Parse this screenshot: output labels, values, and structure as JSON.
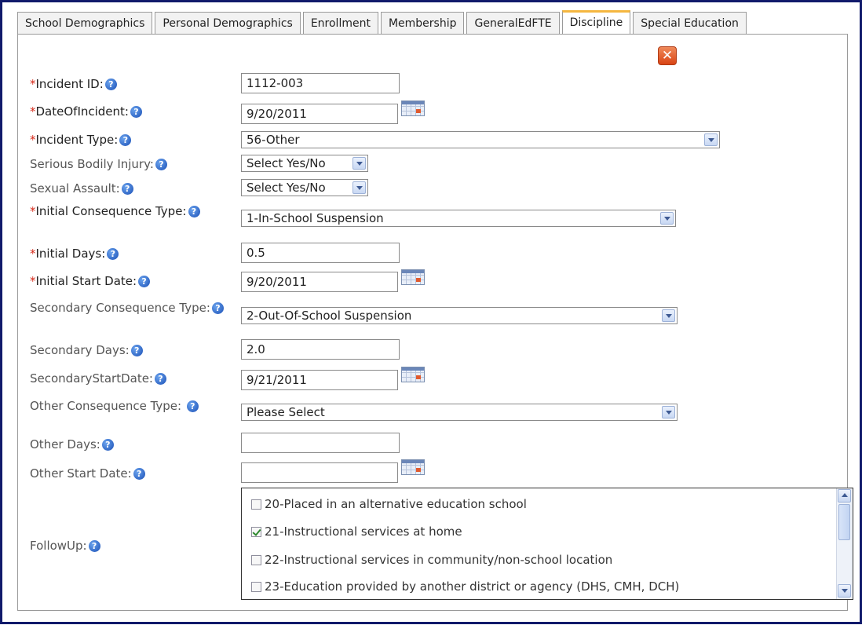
{
  "tabs": [
    {
      "label": "School Demographics",
      "active": false
    },
    {
      "label": "Personal Demographics",
      "active": false
    },
    {
      "label": "Enrollment",
      "active": false
    },
    {
      "label": "Membership",
      "active": false
    },
    {
      "label": "GeneralEdFTE",
      "active": false
    },
    {
      "label": "Discipline",
      "active": true
    },
    {
      "label": "Special Education",
      "active": false
    }
  ],
  "close_glyph": "✕",
  "required_mark": "*",
  "help_glyph": "?",
  "fields": {
    "incident_id": {
      "label": "Incident ID:",
      "value": "1112-003"
    },
    "date_of_incident": {
      "label": "DateOfIncident:",
      "value": "9/20/2011"
    },
    "incident_type": {
      "label": "Incident Type:",
      "value": "56-Other"
    },
    "serious_bodily_injury": {
      "label": "Serious Bodily Injury:",
      "value": "Select Yes/No"
    },
    "sexual_assault": {
      "label": "Sexual Assault:",
      "value": "Select Yes/No"
    },
    "initial_consequence_type": {
      "label": "Initial Consequence Type:",
      "value": "1-In-School Suspension"
    },
    "initial_days": {
      "label": "Initial Days:",
      "value": "0.5"
    },
    "initial_start_date": {
      "label": "Initial Start Date:",
      "value": "9/20/2011"
    },
    "secondary_consequence_type": {
      "label": "Secondary Consequence Type:",
      "value": "2-Out-Of-School Suspension"
    },
    "secondary_days": {
      "label": "Secondary Days:",
      "value": "2.0"
    },
    "secondary_start_date": {
      "label": "SecondaryStartDate:",
      "value": "9/21/2011"
    },
    "other_consequence_type": {
      "label": "Other Consequence Type:",
      "value": "Please Select"
    },
    "other_days": {
      "label": "Other Days:",
      "value": ""
    },
    "other_start_date": {
      "label": "Other Start Date:",
      "value": ""
    },
    "followup": {
      "label": "FollowUp:"
    }
  },
  "followup_options": [
    {
      "label": "20-Placed in an alternative education school",
      "checked": false
    },
    {
      "label": "21-Instructional services at home",
      "checked": true
    },
    {
      "label": "22-Instructional services in community/non-school location",
      "checked": false
    },
    {
      "label": "23-Education provided by another district or agency (DHS, CMH, DCH)",
      "checked": false
    }
  ],
  "colors": {
    "frame": "#111a6b",
    "required": "#d62a1a",
    "active_tab_accent": "#f5b740",
    "close_button": "#e05a2e"
  }
}
